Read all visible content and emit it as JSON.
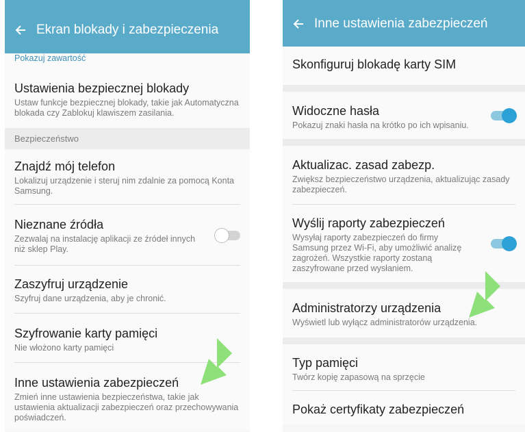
{
  "left": {
    "title": "Ekran blokady i zabezpieczenia",
    "top_link": "Pokazuj zawartość",
    "rows_a": [
      {
        "title": "Ustawienia bezpiecznej blokady",
        "subtitle": "Ustaw funkcje bezpiecznej blokady, takie jak Automatyczna blokada czy Zablokuj klawiszem zasilania."
      }
    ],
    "section": "Bezpieczeństwo",
    "rows_b": [
      {
        "title": "Znajdź mój telefon",
        "subtitle": "Lokalizuj urządzenie i steruj nim zdalnie za pomocą Konta Samsung."
      },
      {
        "title": "Nieznane źródła",
        "subtitle": "Zezwalaj na instalację aplikacji ze źródeł innych niż sklep Play.",
        "switch": "off"
      },
      {
        "title": "Zaszyfruj urządzenie",
        "subtitle": "Szyfruj dane urządzenia, aby je chronić."
      },
      {
        "title": "Szyfrowanie karty pamięci",
        "subtitle": "Nie włożono karty pamięci"
      },
      {
        "title": "Inne ustawienia zabezpieczeń",
        "subtitle": "Zmień inne ustawienia bezpieczeństwa, takie jak ustawienia aktualizacji zabezpieczeń oraz przechowywania poświadczeń."
      }
    ]
  },
  "right": {
    "title": "Inne ustawienia zabezpieczeń",
    "rows": [
      {
        "title": "Skonfiguruj blokadę karty SIM",
        "subtitle": ""
      },
      {
        "title": "Widoczne hasła",
        "subtitle": "Pokazuj znaki hasła na krótko po ich wpisaniu.",
        "switch": "on"
      },
      {
        "title": "Aktualizac. zasad zabezp.",
        "subtitle": "Zwiększ bezpieczeństwo urządzenia, aktualizując zasady zabezpieczeń."
      },
      {
        "title": "Wyślij raporty zabezpieczeń",
        "subtitle": "Wysyłaj raporty zabezpieczeń do firmy Samsung przez Wi-Fi, aby umożliwić analizę zagrożeń. Wszystkie raporty zostaną zaszyfrowane przed wysłaniem.",
        "switch": "on"
      },
      {
        "title": "Administratorzy urządzenia",
        "subtitle": "Wyświetl lub wyłącz administratorów urządzenia."
      },
      {
        "title": "Typ pamięci",
        "subtitle": "Twórz kopię zapasową na sprzęcie"
      },
      {
        "title": "Pokaż certyfikaty zabezpieczeń",
        "subtitle": ""
      }
    ]
  },
  "colors": {
    "appbar": "#5aabc9",
    "accent_link": "#3f8fb6",
    "switch_on": "#2ba1d6",
    "arrow": "#8ee07a"
  },
  "icons": {
    "back": "arrow-left-icon",
    "annotation": "pointer-arrow-icon"
  }
}
